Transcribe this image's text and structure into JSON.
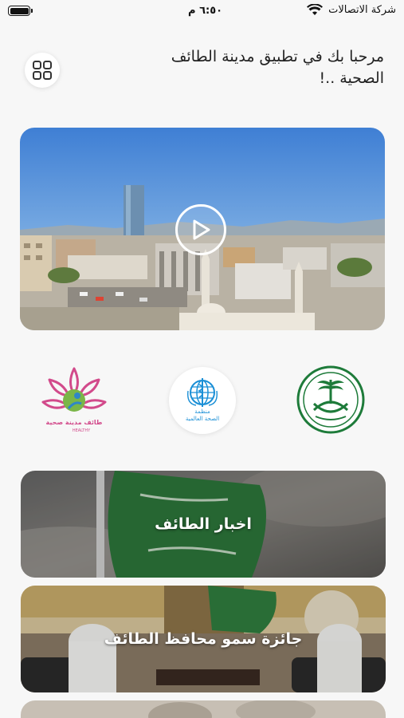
{
  "status_bar": {
    "carrier": "شركة الاتصالات",
    "time": "٦:٥٠ م",
    "icons": [
      "battery-icon",
      "wifi-icon"
    ]
  },
  "header": {
    "welcome_text": "مرحبا بك في تطبيق مدينة الطائف الصحية ..!",
    "menu_icon": "grid-icon"
  },
  "video": {
    "play_icon": "play-icon"
  },
  "partners": {
    "who_name_line1": "منظمة",
    "who_name_line2": "الصحة العالمية",
    "healthy_city_text": "طائف مدينة صحية",
    "healthy_city_en": "HEALTHY"
  },
  "cards": [
    {
      "label": "اخبار الطائف"
    },
    {
      "label": "جائزة سمو محافظ الطائف"
    },
    {
      "label": ""
    }
  ],
  "colors": {
    "background": "#f7f7f7",
    "moi_green": "#1e7b3a",
    "who_blue": "#1a8fd6",
    "healthy_pink": "#d24a8b"
  }
}
